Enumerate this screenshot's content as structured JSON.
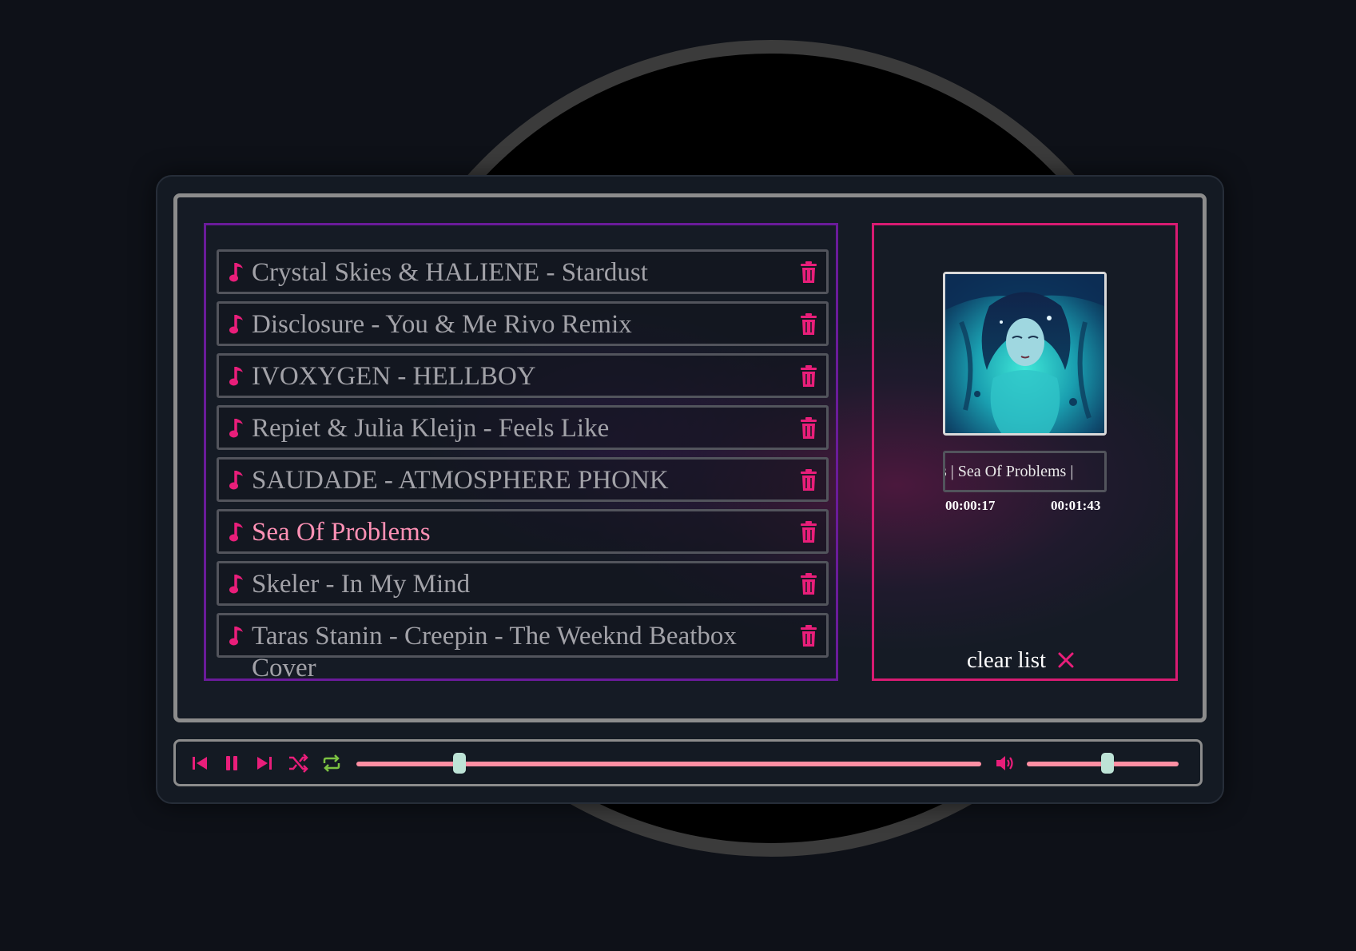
{
  "colors": {
    "accent_pink": "#e91e7a",
    "active_track_text": "#ff91b5",
    "playlist_border": "#6a1b9a",
    "now_playing_border": "#d81b72",
    "slider_fill": "#ff8fa3",
    "slider_thumb": "#bde3d6",
    "repeat_icon": "#7cc242"
  },
  "playlist": {
    "tracks": [
      {
        "title": "Crystal Skies & HALIENE - Stardust",
        "icon": "music-note-icon",
        "active": false
      },
      {
        "title": "Disclosure - You & Me Rivo Remix",
        "icon": "music-note-icon",
        "active": false
      },
      {
        "title": "IVOXYGEN - HELLBOY",
        "icon": "music-note-icon",
        "active": false
      },
      {
        "title": "Repiet & Julia Kleijn - Feels Like",
        "icon": "music-note-icon",
        "active": false
      },
      {
        "title": "SAUDADE - ATMOSPHERE PHONK",
        "icon": "music-note-icon",
        "active": false
      },
      {
        "title": "Sea Of Problems",
        "icon": "music-note-icon",
        "active": true
      },
      {
        "title": "Skeler - In My Mind",
        "icon": "music-note-icon",
        "active": false
      },
      {
        "title": "Taras Stanin - Creepin - The Weeknd Beatbox Cover",
        "icon": "music-note-icon",
        "active": false
      }
    ],
    "delete_icon": "trash-icon"
  },
  "now_playing": {
    "marquee_text": "s | Sea Of Problems |",
    "current_time": "00:00:17",
    "duration": "00:01:43",
    "clear_label": "clear list",
    "clear_icon": "close-icon"
  },
  "controls": {
    "icons": [
      "skip-previous-icon",
      "pause-icon",
      "skip-next-icon",
      "shuffle-icon",
      "repeat-icon",
      "volume-icon"
    ],
    "progress_fraction": 0.165,
    "volume_fraction": 0.49
  }
}
